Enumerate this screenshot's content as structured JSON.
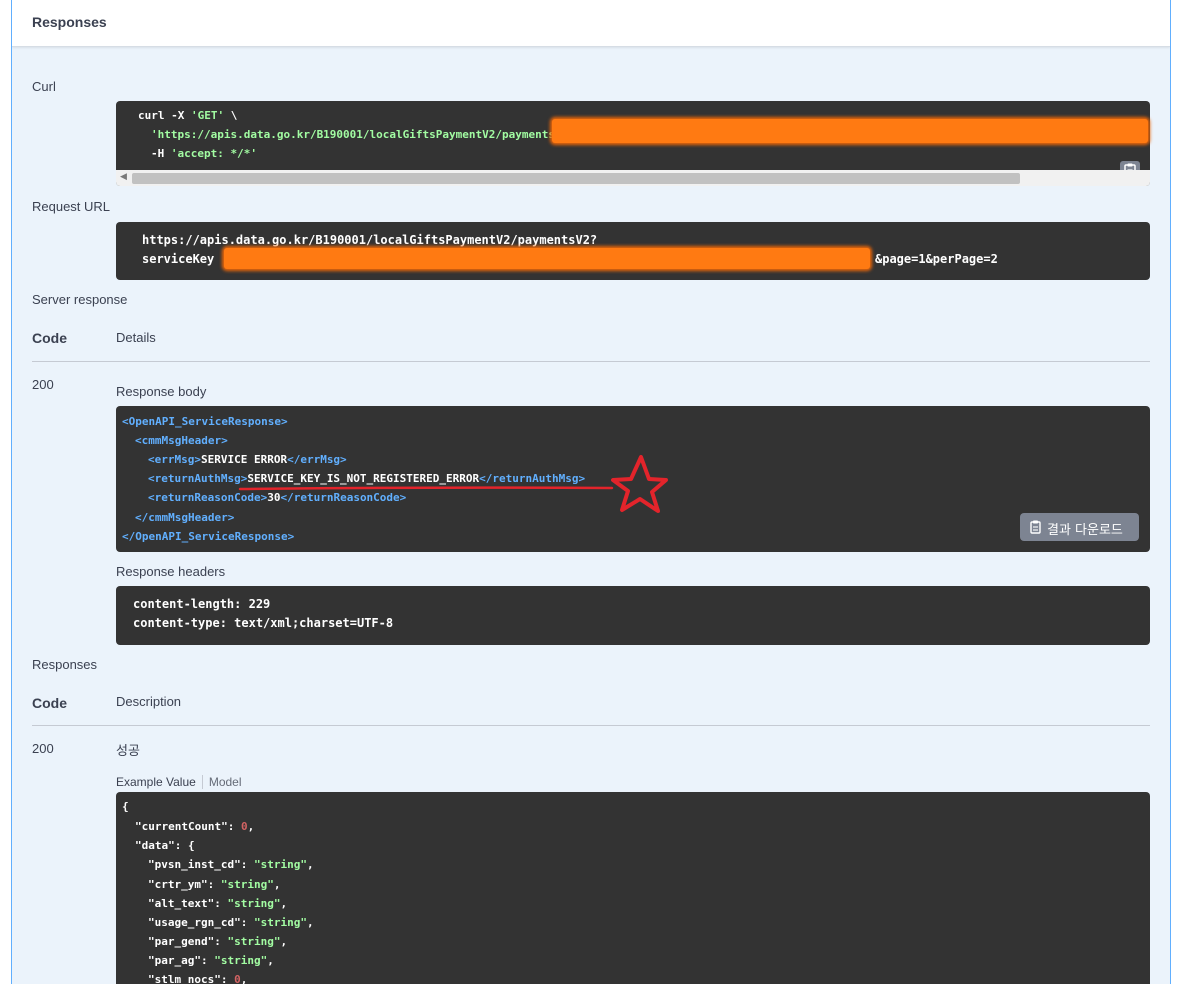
{
  "panel_title": "Responses",
  "curl": {
    "label": "Curl",
    "line1_cmd": "curl -X ",
    "line1_method": "'GET'",
    "line1_tail": " \\",
    "line2": "'https://apis.data.go.kr/B190001/localGiftsPaymentV2/paymentsV2?serviceKey",
    "line3_flag": "-H ",
    "line3_header": "'accept: */*'"
  },
  "request_url": {
    "label": "Request URL",
    "line1": "https://apis.data.go.kr/B190001/localGiftsPaymentV2/paymentsV2?",
    "line2_prefix": "serviceKey",
    "line2_suffix": "&page=1&perPage=2"
  },
  "server_response": {
    "label": "Server response",
    "col_code": "Code",
    "col_details": "Details",
    "code": "200",
    "body_label": "Response body",
    "body": {
      "root_open": "<OpenAPI_ServiceResponse>",
      "header_open": "<cmmMsgHeader>",
      "err_open": "<errMsg>",
      "err_value": "SERVICE ERROR",
      "err_close": "</errMsg>",
      "auth_open": "<returnAuthMsg>",
      "auth_value": "SERVICE_KEY_IS_NOT_REGISTERED_ERROR",
      "auth_close": "</returnAuthMsg>",
      "reason_open": "<returnReasonCode>",
      "reason_value": "30",
      "reason_close": "</returnReasonCode>",
      "header_close": "</cmmMsgHeader>",
      "root_close": "</OpenAPI_ServiceResponse>"
    },
    "download_label": "결과 다운로드",
    "headers_label": "Response headers",
    "headers": [
      "content-length: 229",
      "content-type: text/xml;charset=UTF-8"
    ]
  },
  "responses": {
    "label": "Responses",
    "col_code": "Code",
    "col_description": "Description",
    "code": "200",
    "description": "성공",
    "tab_example": "Example Value",
    "tab_model": "Model",
    "example": {
      "open_brace": "{",
      "currentCount_key": "\"currentCount\"",
      "currentCount_value": "0",
      "data_key": "\"data\"",
      "data_open": "{",
      "fields": [
        {
          "key": "\"pvsn_inst_cd\"",
          "value": "\"string\""
        },
        {
          "key": "\"crtr_ym\"",
          "value": "\"string\""
        },
        {
          "key": "\"alt_text\"",
          "value": "\"string\""
        },
        {
          "key": "\"usage_rgn_cd\"",
          "value": "\"string\""
        },
        {
          "key": "\"par_gend\"",
          "value": "\"string\""
        },
        {
          "key": "\"par_ag\"",
          "value": "\"string\""
        }
      ],
      "last_key": "\"stlm_nocs\"",
      "last_value": "0"
    }
  },
  "colors": {
    "panel_bg": "#ebf3fb",
    "panel_border": "#61affe",
    "code_bg": "#333333",
    "string_green": "#a2fca2",
    "xml_tag_blue": "#61affe",
    "number_red": "#d36363",
    "redaction_orange": "#ff7a12",
    "annotation_red": "#e3242b"
  },
  "icons": {
    "copy": "clipboard-copy-icon",
    "download": "clipboard-download-icon",
    "annotation": "star-icon"
  }
}
